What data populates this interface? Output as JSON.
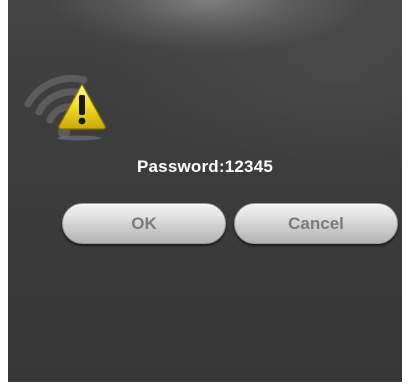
{
  "dialog": {
    "icon": "wifi-warning-icon",
    "message": "Password:12345",
    "ok_label": "OK",
    "cancel_label": "Cancel"
  },
  "colors": {
    "background": "#3a3a3a",
    "text": "#ffffff",
    "button_text": "#7b7b7b",
    "warning": "#f2d214"
  }
}
